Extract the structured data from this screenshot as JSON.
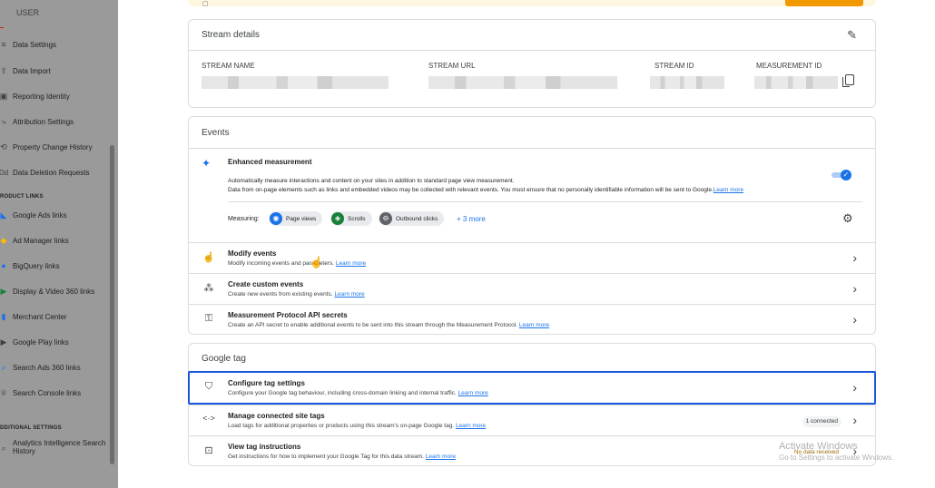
{
  "sidebar": {
    "user": "USER",
    "items": [
      {
        "icon": "database-icon",
        "glyph": "≡",
        "label": "Data Settings"
      },
      {
        "icon": "upload-icon",
        "glyph": "⇧",
        "label": "Data Import"
      },
      {
        "icon": "identity-icon",
        "glyph": "▣",
        "label": "Reporting Identity"
      },
      {
        "icon": "attribution-icon",
        "glyph": "⤷",
        "label": "Attribution Settings"
      },
      {
        "icon": "history-icon",
        "glyph": "⟲",
        "label": "Property Change History"
      },
      {
        "icon": "delete-icon",
        "glyph": "Dd",
        "label": "Data Deletion Requests"
      }
    ],
    "product_links_heading": "RODUCT LINKS",
    "product_links": [
      {
        "icon": "google-ads-icon",
        "glyph": "◣",
        "color": "#1a73e8",
        "label": "Google Ads links"
      },
      {
        "icon": "ad-manager-icon",
        "glyph": "◆",
        "color": "#fbbc04",
        "label": "Ad Manager links"
      },
      {
        "icon": "bigquery-icon",
        "glyph": "●",
        "color": "#1a73e8",
        "label": "BigQuery links"
      },
      {
        "icon": "dv360-icon",
        "glyph": "▶",
        "color": "#188038",
        "label": "Display & Video 360 links"
      },
      {
        "icon": "merchant-center-icon",
        "glyph": "▮",
        "color": "#1a73e8",
        "label": "Merchant Center"
      },
      {
        "icon": "google-play-icon",
        "glyph": "▶",
        "color": "#3c4043",
        "label": "Google Play links"
      },
      {
        "icon": "search-ads-icon",
        "glyph": "🔍",
        "color": "#1a73e8",
        "label": "Search Ads 360 links"
      },
      {
        "icon": "search-console-icon",
        "glyph": "♕",
        "color": "#3c4043",
        "label": "Search Console links"
      }
    ],
    "additional_heading": "DDITIONAL SETTINGS",
    "additional": [
      {
        "icon": "intelligence-icon",
        "glyph": "⌕",
        "label_line1": "Analytics Intelligence Search",
        "label_line2": "History"
      }
    ]
  },
  "stream_details": {
    "title": "Stream details",
    "columns": [
      {
        "label": "STREAM NAME"
      },
      {
        "label": "STREAM URL"
      },
      {
        "label": "STREAM ID"
      },
      {
        "label": "MEASUREMENT ID"
      }
    ]
  },
  "events": {
    "title": "Events",
    "enhanced": {
      "title": "Enhanced measurement",
      "desc_line1": "Automatically measure interactions and content on your sites in addition to standard page view measurement.",
      "desc_line2": "Data from on-page elements such as links and embedded videos may be collected with relevant events. You must ensure that no personally identifiable information will be sent to Google.",
      "learn_more": "Learn more",
      "enabled": true
    },
    "measuring_label": "Measuring:",
    "chips": [
      {
        "label": "Page views",
        "icon": "eye-icon",
        "color": "#1a73e8"
      },
      {
        "label": "Scrolls",
        "icon": "scroll-icon",
        "color": "#188038"
      },
      {
        "label": "Outbound clicks",
        "icon": "lock-icon",
        "color": "#5f6368"
      }
    ],
    "more": "+ 3 more",
    "rows": [
      {
        "title": "Modify events",
        "desc": "Modify incoming events and parameters.",
        "link": "Learn more"
      },
      {
        "title": "Create custom events",
        "desc": "Create new events from existing events.",
        "link": "Learn more"
      },
      {
        "title": "Measurement Protocol API secrets",
        "desc": "Create an API secret to enable additional events to be sent into this stream through the Measurement Protocol.",
        "link": "Learn more"
      }
    ]
  },
  "google_tag": {
    "title": "Google tag",
    "rows": [
      {
        "title": "Configure tag settings",
        "desc": "Configure your Google tag behaviour, including cross-domain linking and internal traffic.",
        "link": "Learn more"
      },
      {
        "title": "Manage connected site tags",
        "desc": "Load tags for additional properties or products using this stream's on-page Google tag.",
        "link": "Learn more",
        "badge": "1 connected"
      },
      {
        "title": "View tag instructions",
        "desc": "Get instructions for how to implement your Google Tag for this data stream.",
        "link": "Learn more",
        "status": "No data received"
      }
    ]
  },
  "watermark": {
    "line1": "Activate Windows",
    "line2": "Go to Settings to activate Windows."
  }
}
